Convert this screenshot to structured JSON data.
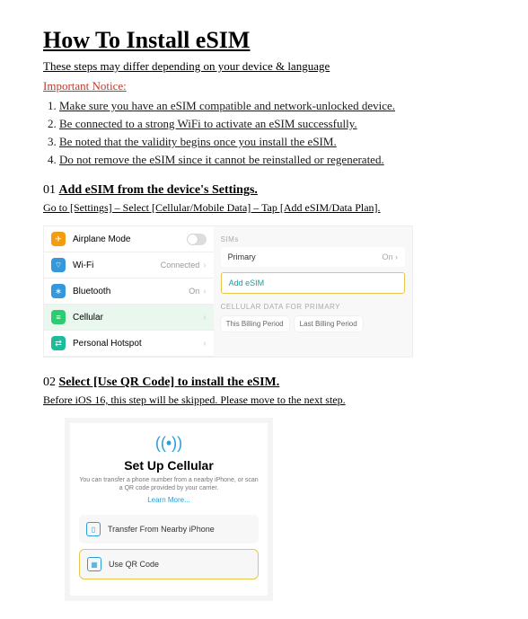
{
  "title": "How To Install eSIM",
  "subtitle": "These steps may differ depending on your device & language",
  "notice": "Important Notice:",
  "rules": [
    "Make sure you have an eSIM compatible and network-unlocked device.",
    "Be connected to a strong WiFi to activate an eSIM successfully.",
    "Be noted that the validity begins once you install the eSIM.",
    "Do not remove the eSIM since it cannot be reinstalled or regenerated."
  ],
  "step1": {
    "num": "01",
    "title": "Add eSIM from the device's Settings.",
    "sub": "Go to [Settings] – Select [Cellular/Mobile Data] – Tap [Add eSIM/Data Plan].",
    "settings": {
      "airplane": "Airplane Mode",
      "wifi": "Wi-Fi",
      "wifi_val": "Connected",
      "bt": "Bluetooth",
      "bt_val": "On",
      "cell": "Cellular",
      "hot": "Personal Hotspot"
    },
    "right": {
      "sims": "SIMs",
      "primary": "Primary",
      "primary_val": "On",
      "add": "Add eSIM",
      "cdp": "CELLULAR DATA FOR PRIMARY",
      "b1": "This Billing Period",
      "b2": "Last Billing Period"
    }
  },
  "step2": {
    "num": "02",
    "title": "Select [Use QR Code] to install the eSIM.",
    "sub": "Before iOS 16, this step will be skipped. Please move to the next step.",
    "panel": {
      "heading": "Set Up Cellular",
      "blurb": "You can transfer a phone number from a nearby iPhone, or scan a QR code provided by your carrier.",
      "learn": "Learn More...",
      "opt1": "Transfer From Nearby iPhone",
      "opt2": "Use QR Code"
    }
  }
}
